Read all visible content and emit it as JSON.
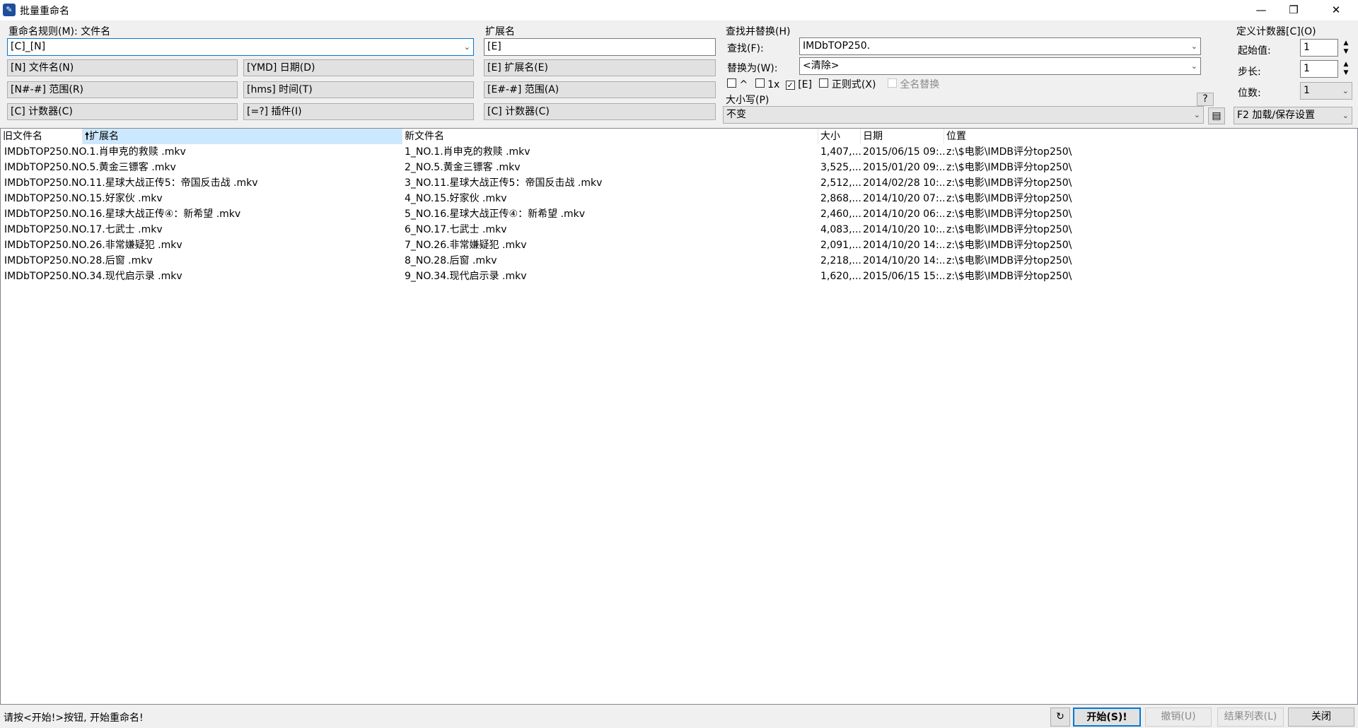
{
  "window": {
    "title": "批量重命名",
    "icon": "app-icon",
    "min_icon": "minimize-icon",
    "max_icon": "restore-icon",
    "close_icon": "close-icon"
  },
  "rename_rule": {
    "label": "重命名规则(M): 文件名",
    "value": "[C]_[N]",
    "buttons": [
      "[N] 文件名(N)",
      "[YMD] 日期(D)",
      "[N#-#] 范围(R)",
      "[hms] 时间(T)",
      "[C] 计数器(C)",
      "[=?] 插件(I)"
    ]
  },
  "extension": {
    "label": "扩展名",
    "value": "[E]",
    "buttons": [
      "[E] 扩展名(E)",
      "[E#-#] 范围(A)",
      "[C] 计数器(C)"
    ]
  },
  "find_replace": {
    "label": "查找并替换(H)",
    "find_label": "查找(F):",
    "find_value": "IMDbTOP250.",
    "replace_label": "替换为(W):",
    "replace_value": "<清除>",
    "options": [
      {
        "label": "^",
        "checked": false
      },
      {
        "label": "1x",
        "checked": false
      },
      {
        "label": "[E]",
        "checked": true
      },
      {
        "label": "正则式(X)",
        "checked": false
      },
      {
        "label": "全名替换",
        "checked": false,
        "disabled": true
      }
    ],
    "case_label": "大小写(P)",
    "case_value": "不变",
    "help": "?"
  },
  "counter": {
    "label": "定义计数器[C](O)",
    "start_label": "起始值:",
    "start_value": "1",
    "step_label": "步长:",
    "step_value": "1",
    "digits_label": "位数:",
    "digits_value": "1",
    "preset": "F2 加载/保存设置"
  },
  "table": {
    "columns": [
      "旧文件名",
      "扩展名",
      "新文件名",
      "大小",
      "日期",
      "位置"
    ],
    "sort_indicator": "arrow-up-icon",
    "rows": [
      [
        "IMDbTOP250.NO.1.肖申克的救赎 .mkv",
        "1_NO.1.肖申克的救赎 .mkv",
        "1,407,...",
        "2015/06/15 09:...",
        "z:\\$电影\\IMDB评分top250\\"
      ],
      [
        "IMDbTOP250.NO.5.黄金三镖客 .mkv",
        "2_NO.5.黄金三镖客 .mkv",
        "3,525,...",
        "2015/01/20 09:...",
        "z:\\$电影\\IMDB评分top250\\"
      ],
      [
        "IMDbTOP250.NO.11.星球大战正传5：帝国反击战 .mkv",
        "3_NO.11.星球大战正传5：帝国反击战 .mkv",
        "2,512,...",
        "2014/02/28 10:...",
        "z:\\$电影\\IMDB评分top250\\"
      ],
      [
        "IMDbTOP250.NO.15.好家伙 .mkv",
        "4_NO.15.好家伙 .mkv",
        "2,868,...",
        "2014/10/20 07:...",
        "z:\\$电影\\IMDB评分top250\\"
      ],
      [
        "IMDbTOP250.NO.16.星球大战正传④：新希望 .mkv",
        "5_NO.16.星球大战正传④：新希望 .mkv",
        "2,460,...",
        "2014/10/20 06:...",
        "z:\\$电影\\IMDB评分top250\\"
      ],
      [
        "IMDbTOP250.NO.17.七武士 .mkv",
        "6_NO.17.七武士 .mkv",
        "4,083,...",
        "2014/10/20 10:...",
        "z:\\$电影\\IMDB评分top250\\"
      ],
      [
        "IMDbTOP250.NO.26.非常嫌疑犯 .mkv",
        "7_NO.26.非常嫌疑犯 .mkv",
        "2,091,...",
        "2014/10/20 14:...",
        "z:\\$电影\\IMDB评分top250\\"
      ],
      [
        "IMDbTOP250.NO.28.后窗  .mkv",
        "8_NO.28.后窗  .mkv",
        "2,218,...",
        "2014/10/20 14:...",
        "z:\\$电影\\IMDB评分top250\\"
      ],
      [
        "IMDbTOP250.NO.34.现代启示录 .mkv",
        "9_NO.34.现代启示录 .mkv",
        "1,620,...",
        "2015/06/15 15:...",
        "z:\\$电影\\IMDB评分top250\\"
      ]
    ]
  },
  "status": {
    "message": "请按<开始!>按钮, 开始重命名!",
    "buttons": {
      "start": "开始(S)!",
      "undo": "撤销(U)",
      "result_list": "结果列表(L)",
      "close": "关闭"
    }
  }
}
